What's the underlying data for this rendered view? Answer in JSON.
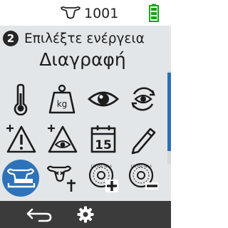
{
  "status": {
    "animal_id": "1001",
    "cow_icon": "cow-head-icon",
    "battery_icon": "battery-icon",
    "battery_color": "#1aa31a"
  },
  "header": {
    "step_number": "2",
    "prompt": "Επιλέξτε ενέργεια",
    "title": "Διαγραφή"
  },
  "actions": [
    {
      "icon": "thermometer-icon"
    },
    {
      "icon": "weight-kg-icon",
      "text": "kg"
    },
    {
      "icon": "eye-icon"
    },
    {
      "icon": "eye-rotate-icon"
    },
    {
      "icon": "alert-plus-icon"
    },
    {
      "icon": "eye-alert-plus-icon"
    },
    {
      "icon": "calendar-icon",
      "text": "15"
    },
    {
      "icon": "pencil-icon"
    },
    {
      "icon": "cow-feeder-icon",
      "selected": true
    },
    {
      "icon": "cow-death-icon"
    },
    {
      "icon": "tag-wheel-add-icon",
      "text": "123 456 789 0"
    },
    {
      "icon": "tag-wheel-remove-icon",
      "text": "123 456 789 0"
    }
  ],
  "nav": {
    "back_icon": "back-arrow-icon",
    "settings_icon": "gear-icon"
  },
  "colors": {
    "accent": "#2e73b9",
    "content_bg": "#e3e6e8",
    "bottom_bar": "#3b3b3b"
  }
}
